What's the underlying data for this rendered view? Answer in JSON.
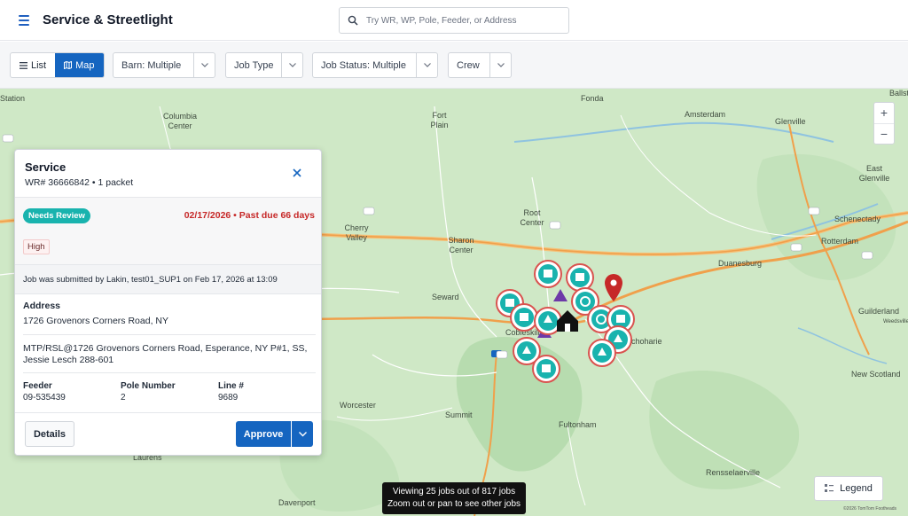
{
  "header": {
    "title": "Service & Streetlight",
    "search_placeholder": "Try WR, WP, Pole, Feeder, or Address"
  },
  "view_toggle": {
    "list_label": "List",
    "map_label": "Map",
    "active": "Map"
  },
  "filters": {
    "barn": "Barn: Multiple",
    "job_type": "Job Type",
    "job_status": "Job Status: Multiple",
    "crew": "Crew"
  },
  "map": {
    "places": [
      "Station",
      "Fonda",
      "Amsterdam",
      "Glenville",
      "Columbia Center",
      "Fort Plain",
      "Root Center",
      "Cherry Valley",
      "Sharon Center",
      "Duanesburg",
      "Seward",
      "Cobleskill",
      "Schoharie",
      "Worcester",
      "Summit",
      "Fultonham",
      "Laurens",
      "Davenport",
      "Rensselaerville",
      "New Scotland",
      "Guilderland",
      "Rotterdam",
      "Schenectady",
      "East Glenville",
      "Ballston",
      "Weedsville"
    ],
    "zoom_in": "+",
    "zoom_out": "−",
    "legend_label": "Legend",
    "viewing_line1": "Viewing 25 jobs out of 817 jobs",
    "viewing_line2": "Zoom out or pan to see other jobs",
    "copyright": "©2026 TomTom Footheads"
  },
  "card": {
    "title": "Service",
    "subtitle": "WR# 36666842 • 1 packet",
    "status_badge": "Needs Review",
    "due_text": "02/17/2026 • Past due 66 days",
    "priority": "High",
    "submitted_text": "Job was submitted by Lakin, test01_SUP1 on Feb 17, 2026 at 13:09",
    "address_label": "Address",
    "address_value": "1726 Grovenors Corners Road, NY",
    "note": "MTP/RSL@1726 Grovenors Corners Road, Esperance, NY P#1, SS, Jessie Lesch 288-601",
    "feeder_label": "Feeder",
    "feeder_value": "09-535439",
    "pole_label": "Pole Number",
    "pole_value": "2",
    "line_label": "Line #",
    "line_value": "9689",
    "details_label": "Details",
    "approve_label": "Approve"
  },
  "colors": {
    "primary": "#1565c0",
    "teal": "#19b3ae",
    "overdue": "#c62828",
    "map_green": "#cfe8c6",
    "road_orange": "#f0a04b"
  }
}
